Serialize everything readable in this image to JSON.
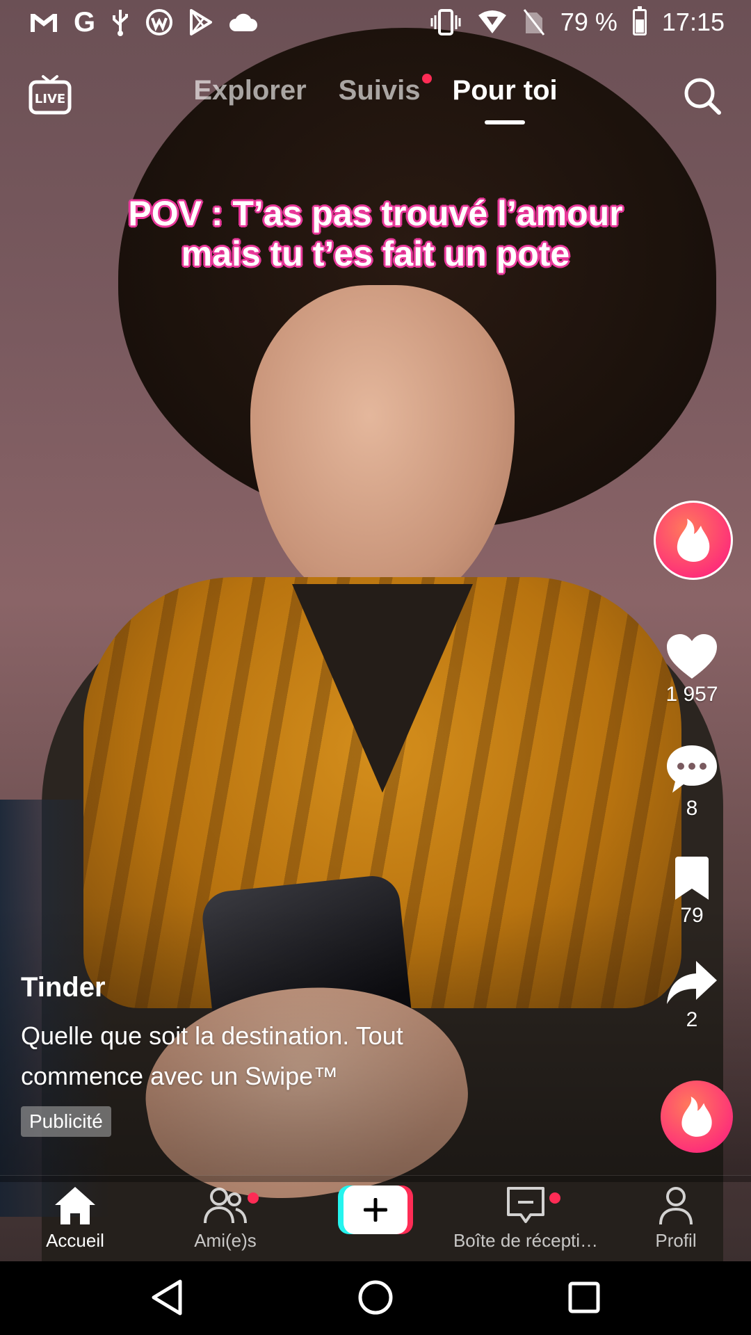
{
  "status_bar": {
    "battery_percent": "79 %",
    "time": "17:15",
    "left_icons": [
      "gmail-icon",
      "google-icon",
      "usb-icon",
      "browser-icon",
      "play-store-icon",
      "cloud-icon"
    ],
    "right_icons": [
      "vibrate-icon",
      "wifi-icon",
      "no-sim-icon",
      "battery-icon"
    ]
  },
  "top_nav": {
    "live_label": "LIVE",
    "tabs": [
      {
        "label": "Explorer",
        "active": false,
        "has_dot": false
      },
      {
        "label": "Suivis",
        "active": false,
        "has_dot": true
      },
      {
        "label": "Pour toi",
        "active": true,
        "has_dot": false
      }
    ]
  },
  "video": {
    "caption_line1": "POV : T’as pas trouvé l’amour",
    "caption_line2": "mais tu t’es fait un pote",
    "caption_outline_color": "#e8389a"
  },
  "actions": {
    "likes": "1 957",
    "comments": "8",
    "saves": "79",
    "shares": "2"
  },
  "post": {
    "author": "Tinder",
    "description_line1": "Quelle que soit la destination. Tout",
    "description_line2": "commence avec un Swipe™",
    "ad_label": "Publicité"
  },
  "bottom_nav": {
    "home": "Accueil",
    "friends": "Ami(e)s",
    "inbox": "Boîte de récepti…",
    "profile": "Profil"
  },
  "colors": {
    "accent_red": "#fe2c55",
    "accent_cyan": "#25f4ee",
    "tinder_gradient_start": "#ff7a5c",
    "tinder_gradient_end": "#fd297b"
  }
}
